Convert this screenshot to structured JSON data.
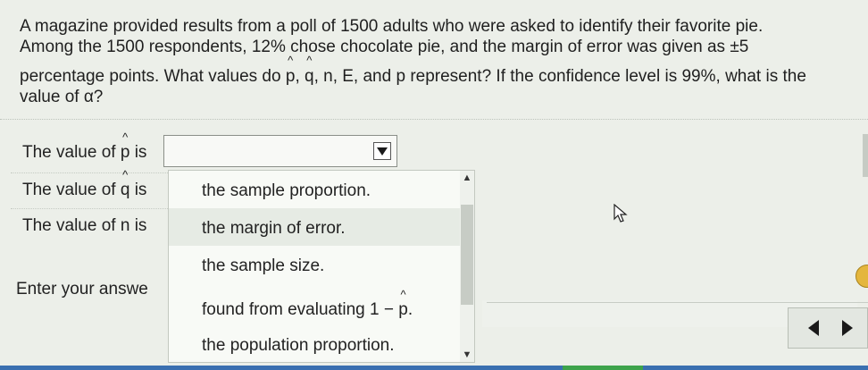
{
  "question": {
    "line1": "A magazine provided results from a poll of 1500 adults who were asked to identify their favorite pie.",
    "line2": "Among the 1500 respondents, 12% chose chocolate pie, and the margin of error was given as ±5",
    "line3_a": "percentage points. What values do ",
    "p": "p",
    "comma1": ", ",
    "q": "q",
    "line3_b": ", n, E, and p represent? If the confidence level is 99%, what is the",
    "line4": "value of α?"
  },
  "rows": {
    "p_label_prefix": "The value of ",
    "p_symbol": "p",
    "p_label_suffix": " is",
    "q_label_prefix": "The value of ",
    "q_symbol": "q",
    "q_label_suffix": " is",
    "n_label": "The value of n is"
  },
  "dropdown": {
    "selected": "",
    "options": {
      "o1": "the sample proportion.",
      "o2": "the margin of error.",
      "o3": "the sample size.",
      "o4_prefix": "found from evaluating 1 − ",
      "o4_symbol": "p",
      "o4_suffix": ".",
      "o5": "the population proportion."
    }
  },
  "enter_answer": "Enter your answe",
  "colors": {
    "background": "#ecefe9",
    "help_button": "#e4b63d"
  }
}
